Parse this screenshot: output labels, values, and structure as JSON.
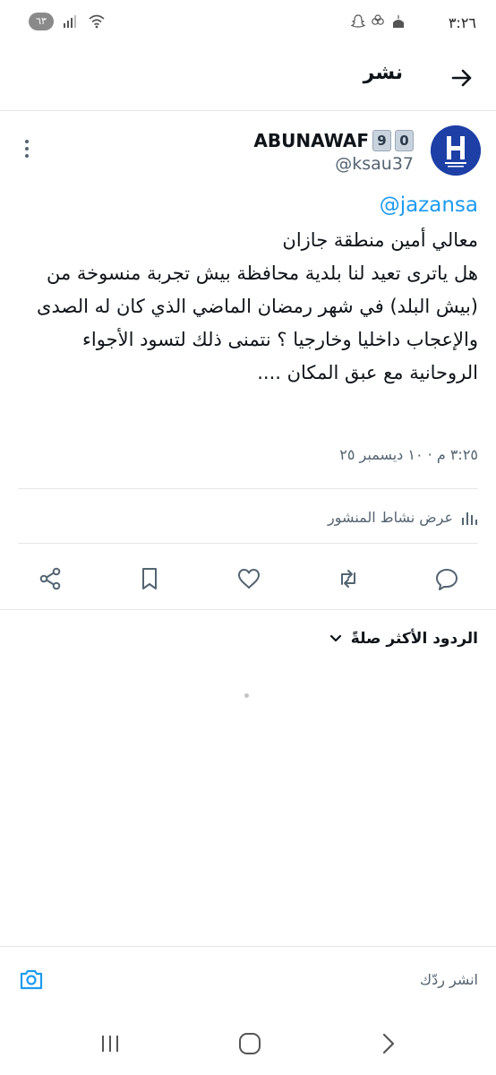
{
  "status_bar": {
    "time": "٣:٢٦",
    "battery": "٦٣"
  },
  "header": {
    "title": "نشر"
  },
  "tweet": {
    "author_name": "ABUNAWAF",
    "author_badge_digits": [
      "9",
      "0"
    ],
    "author_handle": "@ksau37",
    "mention": "@jazansa",
    "text": "معالي أمين منطقة جازان\nهل ياترى تعيد لنا بلدية محافظة بيش تجربة منسوخة من (بيش البلد) في شهر رمضان الماضي الذي كان له الصدى والإعجاب داخليا وخارجيا ؟ نتمنى ذلك لتسود الأجواء الروحانية مع عبق المكان ....",
    "timestamp": "٣:٢٥ م · ١٠ ديسمبر ٢٥",
    "activity_label": "عرض نشاط المنشور"
  },
  "replies": {
    "sort_label": "الردود الأكثر صلةً"
  },
  "composer": {
    "placeholder": "انشر ردّك"
  },
  "colors": {
    "accent": "#1d9bf0",
    "secondary_text": "#536471",
    "avatar_bg": "#1d3fa6"
  }
}
